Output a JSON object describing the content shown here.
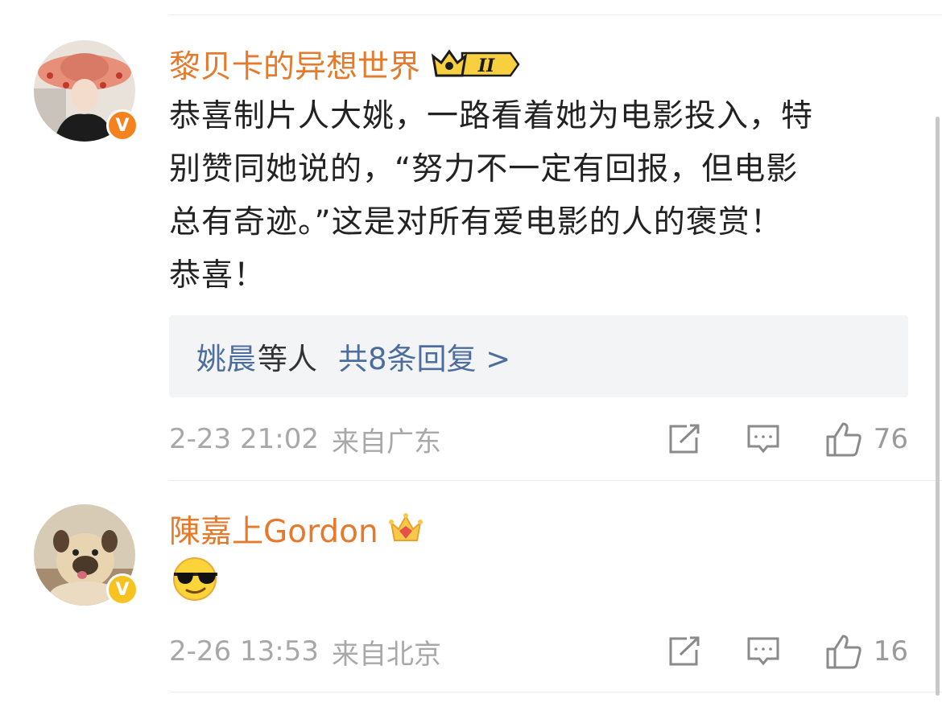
{
  "comments": [
    {
      "username": "黎贝卡的异想世界",
      "verified_badge": "V",
      "badge_color": "#f6821f",
      "text_lines": [
        "恭喜制片人大姚，一路看着她为电影投入，特",
        "别赞同她说的，“努力不一定有回报，但电影",
        "总有奇迹。”这是对所有爱电影的人的褒赏！",
        "恭喜！"
      ],
      "replies": {
        "names": "姚晨",
        "suffix": "等人",
        "count_label": "共8条回复 >"
      },
      "time": "2-23 21:02",
      "location": "来自广东",
      "likes": "76",
      "icons": [
        "crown-level-badge-icon",
        "share-icon",
        "comment-icon",
        "like-icon"
      ]
    },
    {
      "username": "陳嘉上Gordon",
      "verified_badge": "V",
      "badge_color": "#f6c320",
      "emoji": "sunglasses-emoji",
      "time": "2-26 13:53",
      "location": "来自北京",
      "likes": "16",
      "icons": [
        "crown-icon",
        "share-icon",
        "comment-icon",
        "like-icon"
      ]
    }
  ],
  "colors": {
    "username": "#e57a2c",
    "reply_link": "#4d6e9c",
    "meta_gray": "#a8a8a8"
  }
}
